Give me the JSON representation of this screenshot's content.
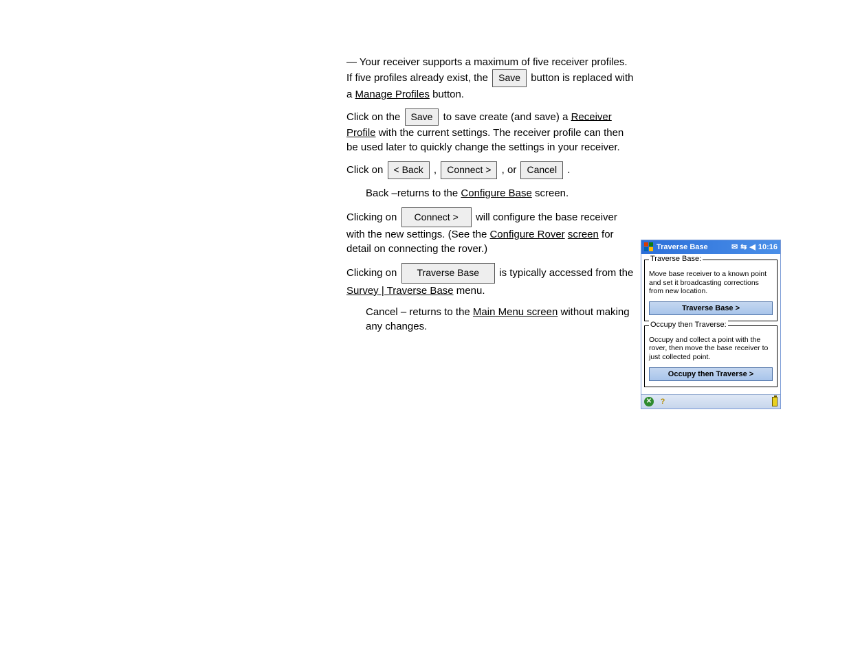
{
  "main": {
    "p1": {
      "a": "— Your receiver supports a maximum of five receiver profiles. If five profiles already exist, the ",
      "btn_save": "Save",
      "b": " button is replaced with a ",
      "link_manage": "Manage Profiles",
      "c": " button."
    },
    "p2": {
      "a": "Click on the ",
      "btn_save": "Save",
      "b": " to save create (and save) a ",
      "link_receiver_profile": "Receiver Profile",
      "c": " with the current settings. The receiver profile can then be used later to quickly change the settings in your receiver."
    },
    "p3": {
      "a": "Click on ",
      "btn_back": "< Back",
      "b": ", ",
      "btn_connect": "Connect >",
      "c": ", or ",
      "btn_cancel": "Cancel",
      "d": "."
    },
    "p4": {
      "a": "Back –returns to the ",
      "link_base_config": "Configure Base",
      "b": " screen."
    },
    "p5": {
      "a": "Clicking on ",
      "btn_connect2": "Connect >",
      "b": " will configure the base receiver with the new settings. (See the ",
      "link_rover": "Configure Rover",
      "c": " ",
      "link_screen": "screen",
      "d": " for detail on connecting the rover.)"
    },
    "p6": {
      "a": "Clicking on ",
      "btn_traverse": "Traverse Base",
      "b": " is typically accessed from the ",
      "link_survey_traverse": "Survey | Traverse Base",
      "c": " menu."
    },
    "p7": {
      "a": "Cancel – returns to the ",
      "link_main_menu": "Main Menu screen",
      "b": " without making any changes."
    }
  },
  "device": {
    "title": "Traverse Base",
    "clock": "10:16",
    "group1": {
      "title": "Traverse Base:",
      "desc": "Move base receiver to a known point and set it broadcasting corrections from new location.",
      "btn": "Traverse Base >"
    },
    "group2": {
      "title": "Occupy then Traverse:",
      "desc": "Occupy and collect a point with the rover, then move the base receiver to just collected point.",
      "btn": "Occupy then Traverse >"
    }
  }
}
